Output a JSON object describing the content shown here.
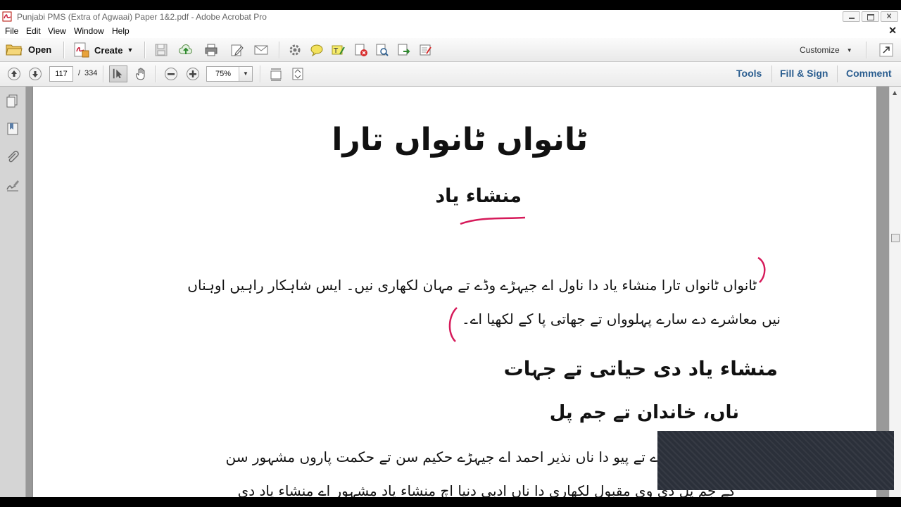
{
  "window": {
    "title": "Punjabi PMS (Extra of Agwaai) Paper 1&2.pdf - Adobe Acrobat Pro"
  },
  "menu": {
    "items": [
      "File",
      "Edit",
      "View",
      "Window",
      "Help"
    ]
  },
  "toolbar": {
    "open_label": "Open",
    "create_label": "Create",
    "customize_label": "Customize"
  },
  "nav": {
    "current_page": "117",
    "page_separator": "/",
    "total_pages": "334",
    "zoom": "75%"
  },
  "panels": {
    "tools": "Tools",
    "fill_sign": "Fill & Sign",
    "comment": "Comment"
  },
  "document": {
    "title": "ٹانواں ٹانواں تارا",
    "author": "منشاء یاد",
    "para1_line1": "ٹانواں ٹانواں تارا منشاء یاد دا ناول اے جیہڑے وڈے تے مہان لکھاری نیں۔ ایس شاہکار راہیں اوہناں",
    "para1_line2": "نیں معاشرے دے سارے پہلوواں تے جھاتی پا کے لکھیا اے۔",
    "heading1": "منشاء یاد دی حیاتی تے جہات",
    "heading2": "ناں، خاندان تے جم پل",
    "para2_line1": "محمد منشاء اے تے پیو دا ناں نذیر احمد اے جیہڑے حکیم سن تے حکمت پاروں مشہور سن",
    "para2_line2": "کے جم پل دی وی مقبول لکھاری دا ناں ادبی دنیا اچ منشاء یاد مشہور اے منشاء یاد دی"
  }
}
